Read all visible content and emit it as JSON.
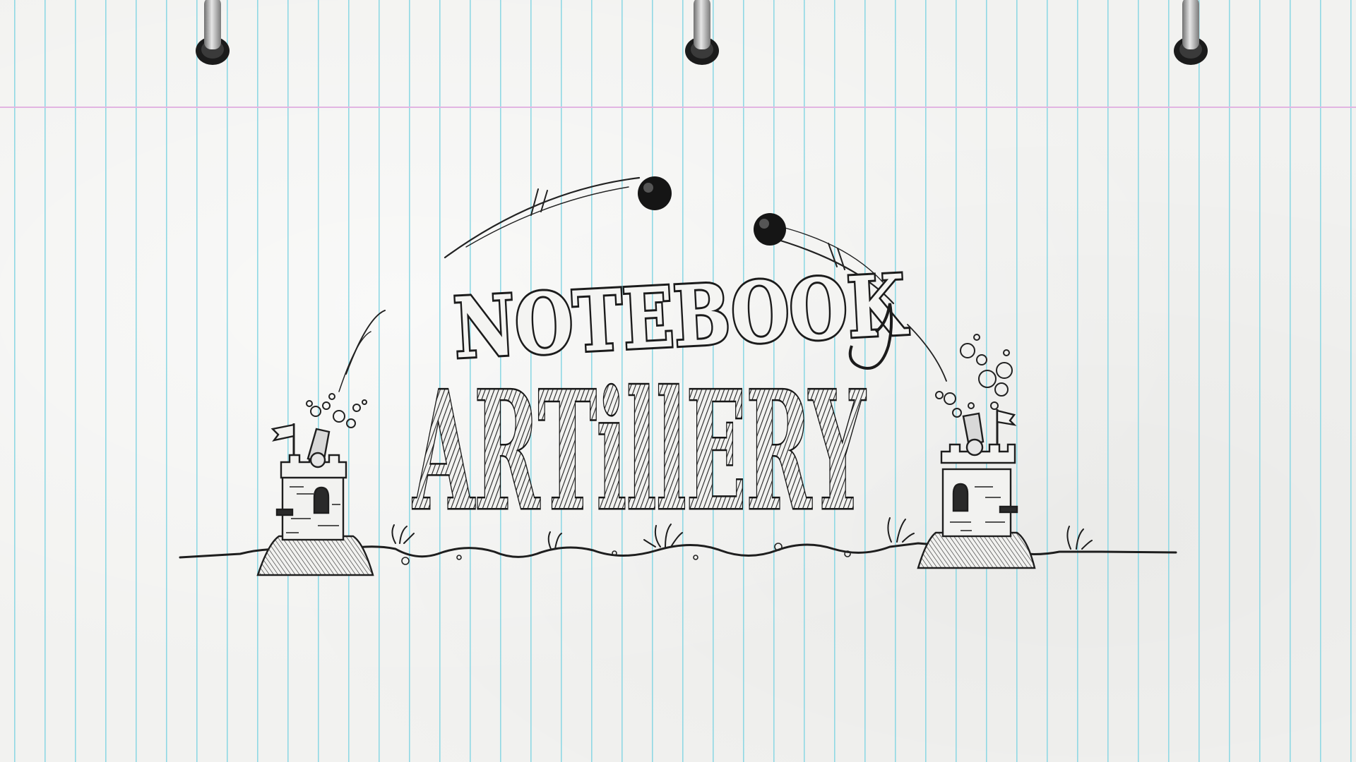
{
  "game": {
    "title_line1": "NOTEBOOK",
    "title_line2": "ARTillERY"
  },
  "colors": {
    "paper": "#f2f2f0",
    "rule_line": "#8fd8e4",
    "margin_line": "#e2b5e2",
    "pencil": "#1e1e1e",
    "ring_metal": "#9a9a9a"
  },
  "icons": {
    "binder_ring": "binder-ring-icon",
    "castle": "castle-tower-icon",
    "cannon": "cannon-icon",
    "cannonball": "cannonball-icon",
    "flag": "flag-icon"
  }
}
